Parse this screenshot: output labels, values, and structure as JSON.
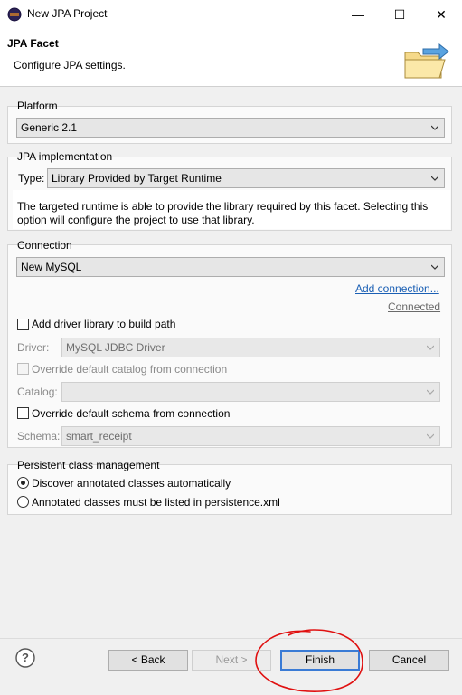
{
  "window": {
    "title": "New JPA Project",
    "minimize_symbol": "—",
    "maximize_symbol": "☐",
    "close_symbol": "✕"
  },
  "header": {
    "title": "JPA Facet",
    "description": "Configure JPA settings.",
    "icon": "folder-arrow-icon"
  },
  "platform": {
    "group_label": "Platform",
    "selected": "Generic 2.1"
  },
  "jpa_implementation": {
    "group_label": "JPA implementation",
    "type_label": "Type:",
    "type_selected": "Library Provided by Target Runtime",
    "info_line1": "The targeted runtime is able to provide the library required by this facet. Selecting this",
    "info_line2": "option will configure the project to use that library."
  },
  "connection": {
    "group_label": "Connection",
    "selected": "New MySQL",
    "add_connection_link": "Add connection...",
    "status": "Connected",
    "add_driver_label": "Add driver library to build path",
    "add_driver_checked": false,
    "driver_label": "Driver:",
    "driver_value": "MySQL JDBC Driver",
    "override_catalog_label": "Override default catalog from connection",
    "catalog_label": "Catalog:",
    "catalog_value": "",
    "override_schema_label": "Override default schema from connection",
    "override_schema_checked": false,
    "schema_label": "Schema:",
    "schema_value": "smart_receipt"
  },
  "persistent_class": {
    "group_label": "Persistent class management",
    "option1": "Discover annotated classes automatically",
    "option2": "Annotated classes must be listed in persistence.xml",
    "selected_option": "option1"
  },
  "footer": {
    "help_symbol": "?",
    "back": "< Back",
    "next": "Next >",
    "finish": "Finish",
    "cancel": "Cancel"
  },
  "colors": {
    "link": "#1a5fb4",
    "annotation_circle": "#e01010",
    "default_button_border": "#3a7bd5"
  }
}
